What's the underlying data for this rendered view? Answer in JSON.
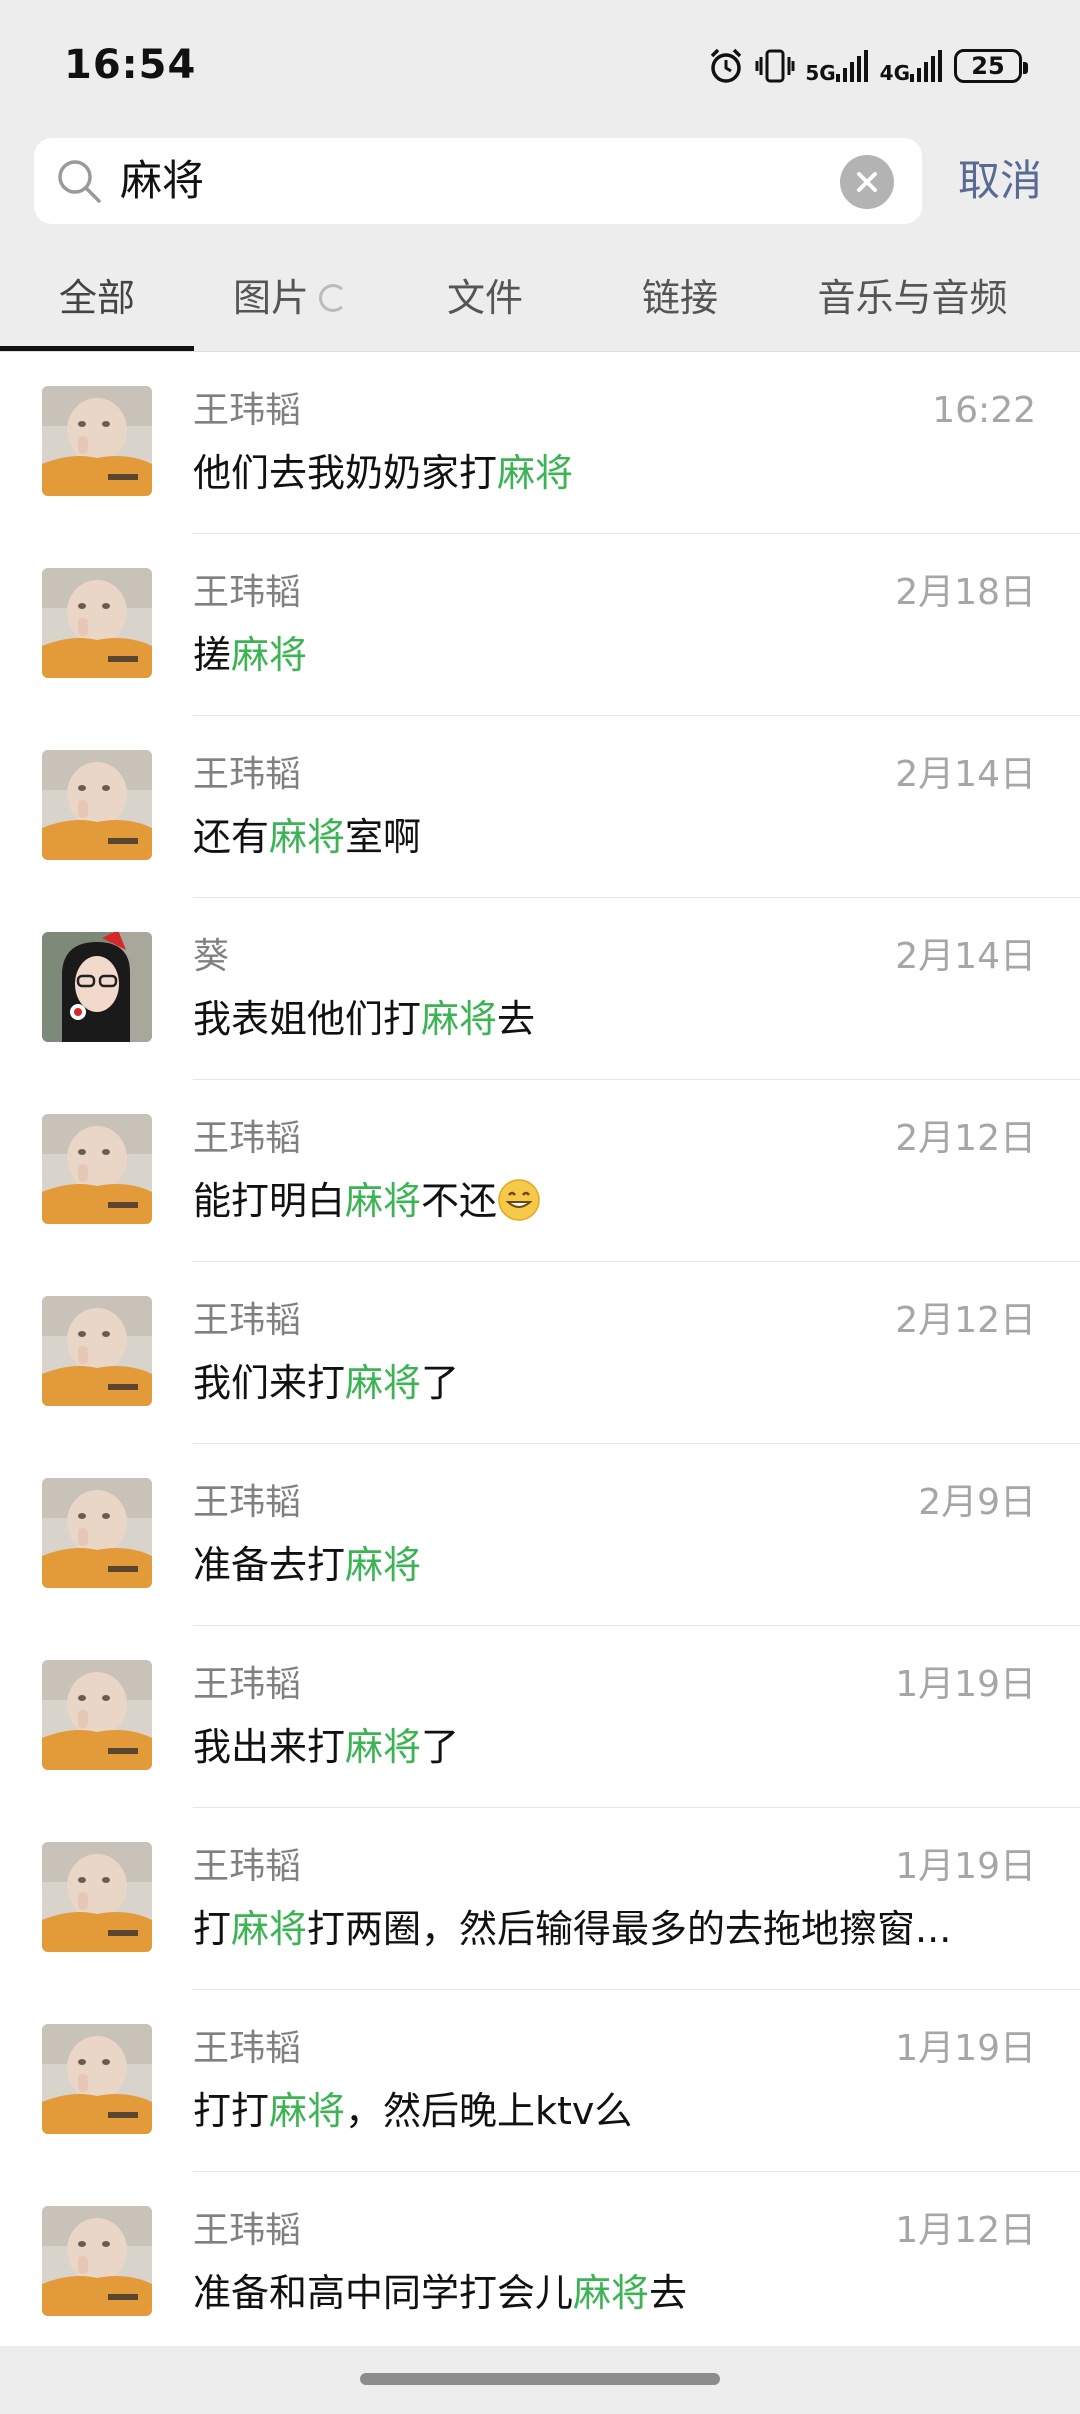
{
  "status": {
    "time": "16:54",
    "net1": "5G",
    "net2": "4G",
    "battery": "25"
  },
  "search": {
    "query": "麻将",
    "cancel_label": "取消"
  },
  "tabs": [
    {
      "label": "全部"
    },
    {
      "label": "图片"
    },
    {
      "label": "文件"
    },
    {
      "label": "链接"
    },
    {
      "label": "音乐与音频"
    }
  ],
  "colors": {
    "highlight": "#3cb453",
    "link": "#576b95"
  },
  "results": [
    {
      "sender": "王玮韬",
      "date": "16:22",
      "pre": "他们去我奶奶家打",
      "hit": "麻将",
      "post": ""
    },
    {
      "sender": "王玮韬",
      "date": "2月18日",
      "pre": "搓",
      "hit": "麻将",
      "post": ""
    },
    {
      "sender": "王玮韬",
      "date": "2月14日",
      "pre": "还有",
      "hit": "麻将",
      "post": "室啊"
    },
    {
      "sender": "葵",
      "date": "2月14日",
      "pre": "我表姐他们打",
      "hit": "麻将",
      "post": "去"
    },
    {
      "sender": "王玮韬",
      "date": "2月12日",
      "pre": "能打明白",
      "hit": "麻将",
      "post": "不还"
    },
    {
      "sender": "王玮韬",
      "date": "2月12日",
      "pre": "我们来打",
      "hit": "麻将",
      "post": "了"
    },
    {
      "sender": "王玮韬",
      "date": "2月9日",
      "pre": "准备去打",
      "hit": "麻将",
      "post": ""
    },
    {
      "sender": "王玮韬",
      "date": "1月19日",
      "pre": "我出来打",
      "hit": "麻将",
      "post": "了"
    },
    {
      "sender": "王玮韬",
      "date": "1月19日",
      "pre": "打",
      "hit": "麻将",
      "post": "打两圈，然后输得最多的去拖地擦窗..."
    },
    {
      "sender": "王玮韬",
      "date": "1月19日",
      "pre": "打打",
      "hit": "麻将",
      "post": "，然后晚上ktv么"
    },
    {
      "sender": "王玮韬",
      "date": "1月12日",
      "pre": "准备和高中同学打会儿",
      "hit": "麻将",
      "post": "去"
    }
  ]
}
